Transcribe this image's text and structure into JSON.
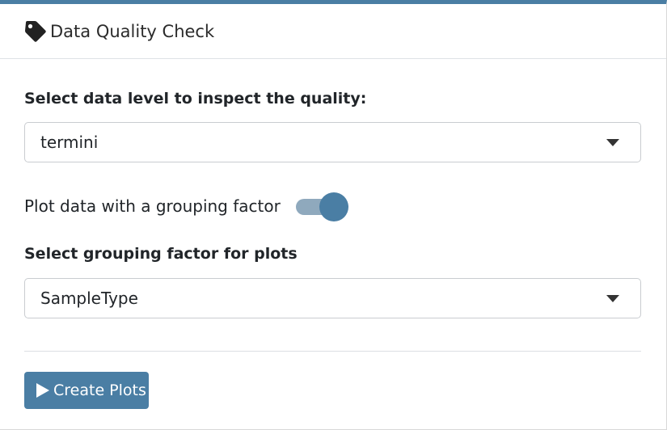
{
  "header": {
    "title": "Data Quality Check",
    "icon": "tag-icon"
  },
  "data_level": {
    "label": "Select data level to inspect the quality:",
    "selected": "termini"
  },
  "grouping_toggle": {
    "label": "Plot data with a grouping factor",
    "on": true
  },
  "grouping_factor": {
    "label": "Select grouping factor for plots",
    "selected": "SampleType"
  },
  "actions": {
    "create_label": "Create Plots",
    "create_icon": "play-icon"
  },
  "colors": {
    "accent": "#4a7ea4",
    "toggle_track": "#8fa9bd"
  }
}
